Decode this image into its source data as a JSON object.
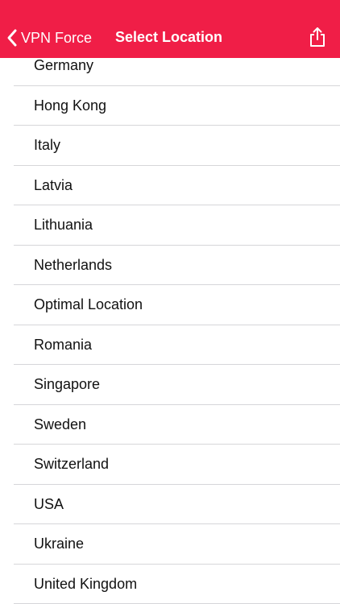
{
  "colors": {
    "accent": "#f01e47",
    "nav_text": "#ffffff",
    "row_text": "#111111",
    "separator": "#d6d6d9"
  },
  "navbar": {
    "back_label": "VPN Force",
    "back_icon": "chevron-left-icon",
    "title": "Select Location",
    "share_icon": "share-icon"
  },
  "locations": [
    "Germany",
    "Hong Kong",
    "Italy",
    "Latvia",
    "Lithuania",
    "Netherlands",
    "Optimal Location",
    "Romania",
    "Singapore",
    "Sweden",
    "Switzerland",
    "USA",
    "Ukraine",
    "United Kingdom"
  ]
}
